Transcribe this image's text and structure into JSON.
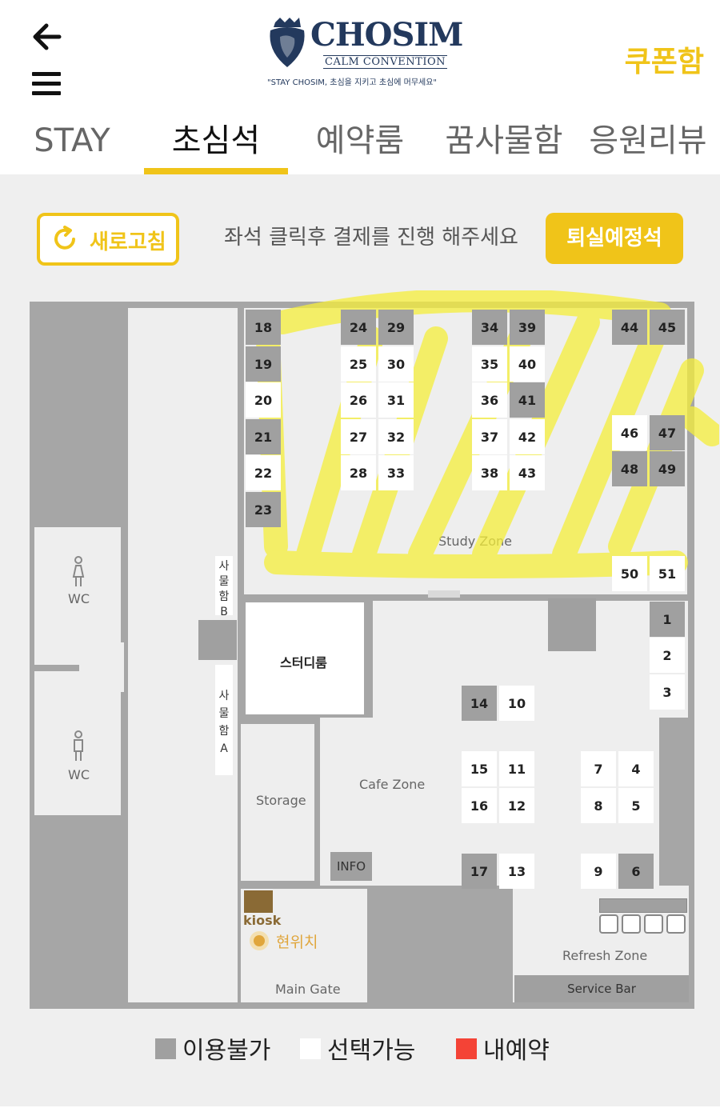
{
  "header": {
    "logo_title": "CHOSIM",
    "logo_subtitle": "CALM CONVENTION",
    "logo_slogan": "\"STAY CHOSIM, 초심을 지키고 초심에 머무세요\"",
    "coupon_label": "쿠폰함",
    "icons": {
      "back": "arrow-left-icon",
      "menu": "hamburger-menu-icon"
    }
  },
  "tabs": [
    {
      "label": "STAY",
      "active": false
    },
    {
      "label": "초심석",
      "active": true
    },
    {
      "label": "예약룸",
      "active": false
    },
    {
      "label": "꿈사물함",
      "active": false
    },
    {
      "label": "응원리뷰",
      "active": false
    }
  ],
  "toolbar": {
    "refresh_label": "새로고침",
    "instruction": "좌석 클릭후 결제를 진행 해주세요",
    "checkout_label": "퇴실예정석"
  },
  "map": {
    "study_zone": "Study Zone",
    "cafe_zone": "Cafe Zone",
    "refresh_zone": "Refresh Zone",
    "service_bar": "Service Bar",
    "storage": "Storage",
    "study_room": "스터디룸",
    "info": "INFO",
    "kiosk": "kiosk",
    "current_location": "현위치",
    "main_gate": "Main Gate",
    "wc_women": "WC",
    "wc_men": "WC",
    "locker_b": [
      "사",
      "물",
      "함",
      "B"
    ],
    "locker_a": [
      "사",
      "물",
      "함",
      "A"
    ]
  },
  "seats": [
    {
      "n": "18",
      "s": "unavailable"
    },
    {
      "n": "19",
      "s": "unavailable"
    },
    {
      "n": "20",
      "s": "available"
    },
    {
      "n": "21",
      "s": "unavailable"
    },
    {
      "n": "22",
      "s": "available"
    },
    {
      "n": "23",
      "s": "unavailable"
    },
    {
      "n": "24",
      "s": "unavailable"
    },
    {
      "n": "25",
      "s": "available"
    },
    {
      "n": "26",
      "s": "available"
    },
    {
      "n": "27",
      "s": "available"
    },
    {
      "n": "28",
      "s": "available"
    },
    {
      "n": "29",
      "s": "unavailable"
    },
    {
      "n": "30",
      "s": "available"
    },
    {
      "n": "31",
      "s": "available"
    },
    {
      "n": "32",
      "s": "available"
    },
    {
      "n": "33",
      "s": "available"
    },
    {
      "n": "34",
      "s": "unavailable"
    },
    {
      "n": "35",
      "s": "available"
    },
    {
      "n": "36",
      "s": "available"
    },
    {
      "n": "37",
      "s": "available"
    },
    {
      "n": "38",
      "s": "available"
    },
    {
      "n": "39",
      "s": "unavailable"
    },
    {
      "n": "40",
      "s": "available"
    },
    {
      "n": "41",
      "s": "unavailable"
    },
    {
      "n": "42",
      "s": "available"
    },
    {
      "n": "43",
      "s": "available"
    },
    {
      "n": "44",
      "s": "unavailable"
    },
    {
      "n": "45",
      "s": "unavailable"
    },
    {
      "n": "46",
      "s": "available"
    },
    {
      "n": "47",
      "s": "unavailable"
    },
    {
      "n": "48",
      "s": "unavailable"
    },
    {
      "n": "49",
      "s": "unavailable"
    },
    {
      "n": "50",
      "s": "available"
    },
    {
      "n": "51",
      "s": "available"
    },
    {
      "n": "1",
      "s": "unavailable"
    },
    {
      "n": "2",
      "s": "available"
    },
    {
      "n": "3",
      "s": "available"
    },
    {
      "n": "14",
      "s": "unavailable"
    },
    {
      "n": "10",
      "s": "available"
    },
    {
      "n": "15",
      "s": "available"
    },
    {
      "n": "11",
      "s": "available"
    },
    {
      "n": "16",
      "s": "available"
    },
    {
      "n": "12",
      "s": "available"
    },
    {
      "n": "17",
      "s": "unavailable"
    },
    {
      "n": "13",
      "s": "available"
    },
    {
      "n": "7",
      "s": "available"
    },
    {
      "n": "4",
      "s": "available"
    },
    {
      "n": "8",
      "s": "available"
    },
    {
      "n": "5",
      "s": "available"
    },
    {
      "n": "9",
      "s": "available"
    },
    {
      "n": "6",
      "s": "unavailable"
    }
  ],
  "legend": [
    {
      "label": "이용불가",
      "color": "#a0a0a0"
    },
    {
      "label": "선택가능",
      "color": "#ffffff"
    },
    {
      "label": "내예약",
      "color": "#f44336"
    }
  ],
  "colors": {
    "accent": "#f0c419",
    "brand_navy": "#23395d",
    "unavailable": "#a0a0a0",
    "mine": "#f44336"
  }
}
